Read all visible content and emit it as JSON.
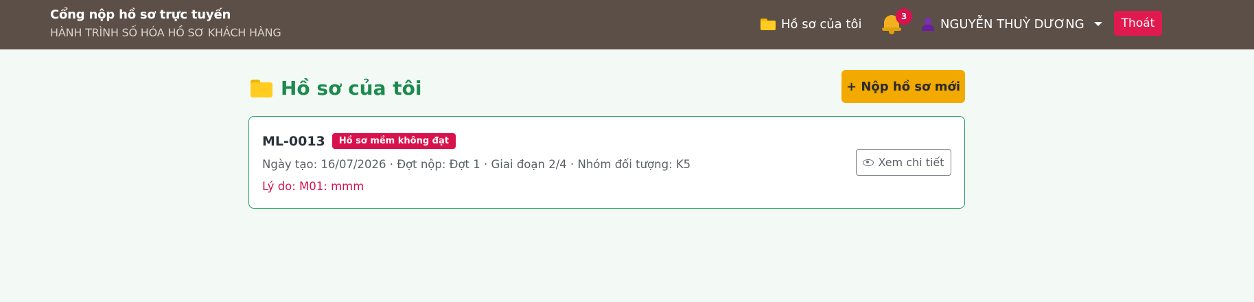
{
  "header": {
    "title": "Cổng nộp hồ sơ trực tuyến",
    "subtitle": "HÀNH TRÌNH SỐ HÓA HỒ SƠ KHÁCH HÀNG",
    "nav_files_label": "Hồ sơ của tôi",
    "notification_count": "3",
    "user_name": "NGUYỄN THUỲ DƯƠNG",
    "logout_label": "Thoát"
  },
  "main": {
    "title": "Hồ sơ của tôi",
    "new_button_label": "+ Nộp hồ sơ mới",
    "records": [
      {
        "code": "ML-0013",
        "status": "Hồ sơ mềm không đạt",
        "meta": "Ngày tạo: 16/07/2026 · Đợt nộp: Đợt 1 · Giai đoạn 2/4 · Nhóm đối tượng: K5",
        "reason": "Lý do: M01: mmm",
        "detail_label": "Xem chi tiết"
      }
    ]
  },
  "colors": {
    "header_bg": "#5c4f47",
    "page_bg": "#f3f9f5",
    "accent_green": "#1c8a4e",
    "primary_button": "#f2a900",
    "danger": "#d8124c"
  },
  "icons": [
    "folder-icon",
    "bell-icon",
    "user-icon",
    "chevron-down-icon",
    "eye-icon"
  ]
}
